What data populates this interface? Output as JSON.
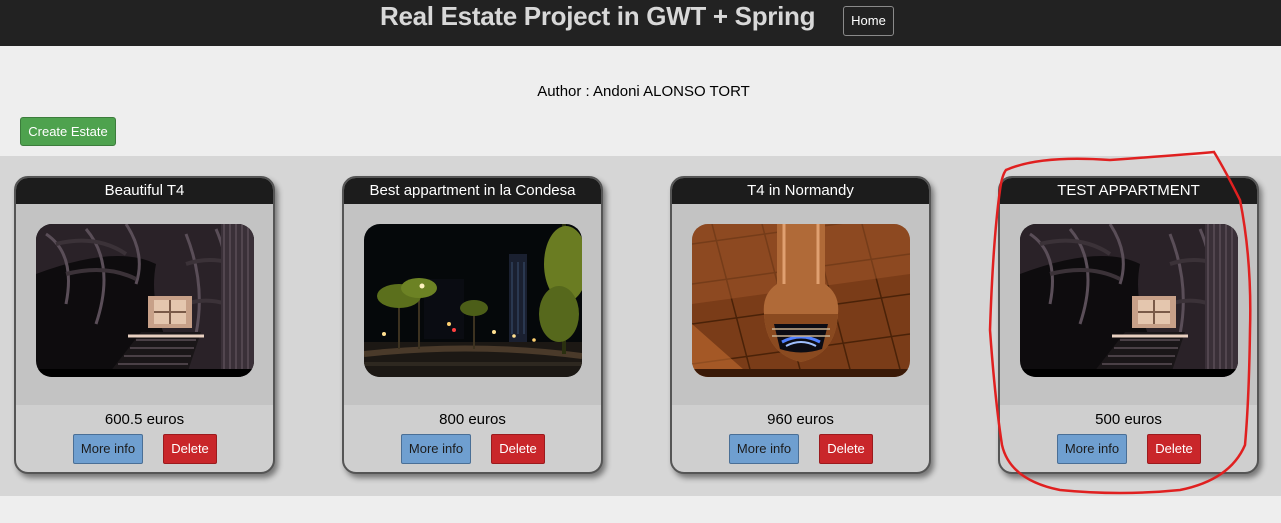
{
  "header": {
    "title": "Real Estate Project in GWT + Spring",
    "home_label": "Home"
  },
  "author_text": "Author : Andoni ALONSO TORT",
  "create_label": "Create Estate",
  "colors": {
    "topbar": "#222222",
    "create_button": "#4ea24e",
    "more_info_button": "#6f9fd0",
    "delete_button": "#c9262a",
    "card_header": "#1c1c1c",
    "annotation_stroke": "#e02020"
  },
  "cards": [
    {
      "title": "Beautiful T4",
      "price": "600.5 euros",
      "more_label": "More info",
      "delete_label": "Delete",
      "image": "dark-interior-photo"
    },
    {
      "title": "Best appartment in la Condesa",
      "price": "800 euros",
      "more_label": "More info",
      "delete_label": "Delete",
      "image": "night-street-photo"
    },
    {
      "title": "T4 in Normandy",
      "price": "960 euros",
      "more_label": "More info",
      "delete_label": "Delete",
      "image": "copper-fireplace-photo"
    },
    {
      "title": "TEST APPARTMENT",
      "price": "500 euros",
      "more_label": "More info",
      "delete_label": "Delete",
      "image": "dark-interior-photo"
    }
  ]
}
